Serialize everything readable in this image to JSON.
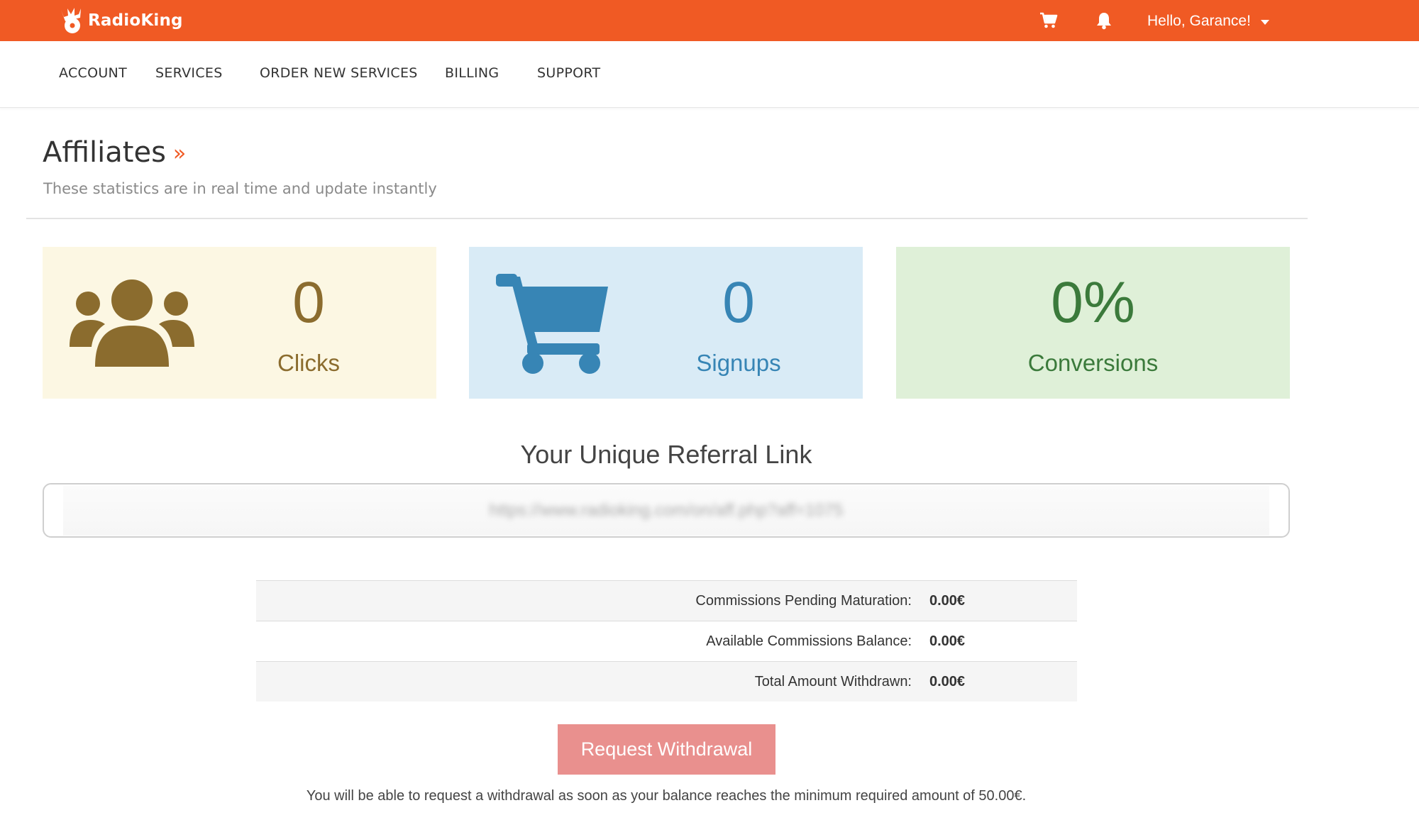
{
  "header": {
    "logo_text": "RadioKing",
    "greeting": "Hello, Garance!",
    "cart_icon": "cart-icon",
    "bell_icon": "bell-icon"
  },
  "nav": {
    "items": [
      {
        "label": "ACCOUNT"
      },
      {
        "label": "SERVICES"
      },
      {
        "label": "ORDER NEW SERVICES"
      },
      {
        "label": "BILLING"
      },
      {
        "label": "SUPPORT"
      }
    ]
  },
  "page": {
    "title": "Affiliates",
    "title_suffix": "»",
    "subtitle": "These statistics are in real time and update instantly"
  },
  "stats": {
    "clicks": {
      "value": "0",
      "label": "Clicks",
      "icon": "users-icon",
      "color": "#8b6c2e",
      "bg": "#fcf7e3"
    },
    "signups": {
      "value": "0",
      "label": "Signups",
      "icon": "cart-icon",
      "color": "#3785b5",
      "bg": "#d9ebf6"
    },
    "conversions": {
      "value": "0%",
      "label": "Conversions",
      "color": "#3b7a3b",
      "bg": "#dff0d8"
    }
  },
  "referral": {
    "heading": "Your Unique Referral Link",
    "link": "https://www.radioking.com/on/aff.php?aff=1075"
  },
  "commissions": {
    "rows": [
      {
        "label": "Commissions Pending Maturation:",
        "value": "0.00€"
      },
      {
        "label": "Available Commissions Balance:",
        "value": "0.00€"
      },
      {
        "label": "Total Amount Withdrawn:",
        "value": "0.00€"
      }
    ]
  },
  "withdrawal": {
    "button_label": "Request Withdrawal",
    "note": "You will be able to request a withdrawal as soon as your balance reaches the minimum required amount of 50.00€."
  },
  "colors": {
    "brand": "#f05a24",
    "withdraw_button": "#e9908e"
  }
}
